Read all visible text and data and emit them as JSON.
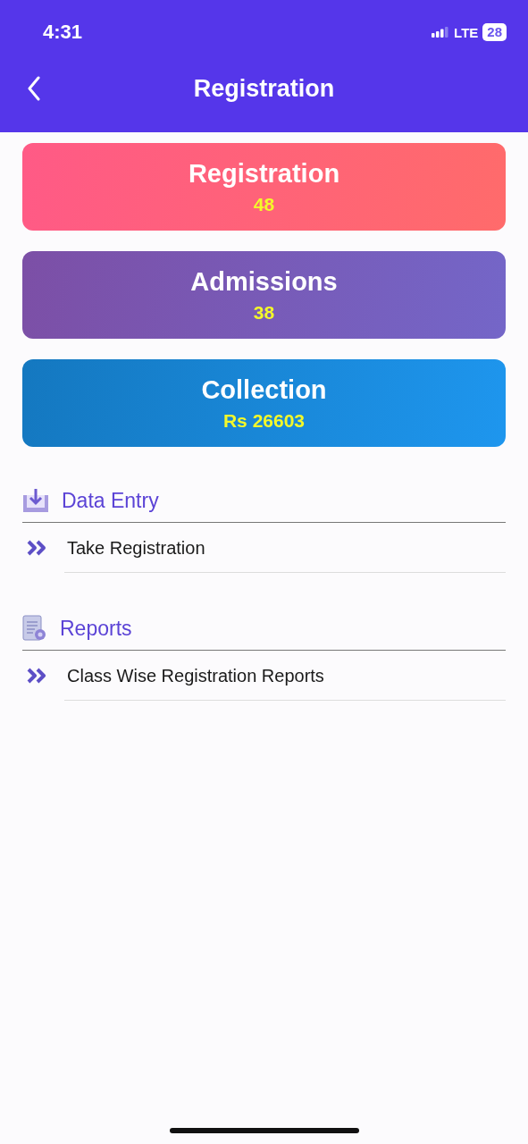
{
  "status_bar": {
    "time": "4:31",
    "network": "LTE",
    "battery": "28"
  },
  "nav": {
    "title": "Registration"
  },
  "cards": [
    {
      "kind": "pink",
      "title": "Registration",
      "value": "48"
    },
    {
      "kind": "purple",
      "title": "Admissions",
      "value": "38"
    },
    {
      "kind": "blue",
      "title": "Collection",
      "value": "Rs 26603"
    }
  ],
  "sections": [
    {
      "kind": "download",
      "title": "Data Entry",
      "items": [
        "Take Registration"
      ]
    },
    {
      "kind": "report",
      "title": "Reports",
      "items": [
        "Class Wise Registration Reports"
      ]
    }
  ]
}
